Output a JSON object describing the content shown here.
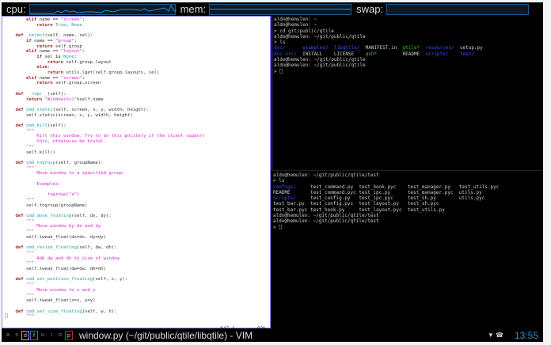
{
  "topbar": {
    "cpu_label": "cpu:",
    "mem_label": "mem:",
    "swap_label": "swap:"
  },
  "vim": {
    "lines": [
      [
        [
          "        ",
          ""
        ],
        [
          "elif",
          "k"
        ],
        [
          " name == ",
          ""
        ],
        [
          "\"screen\"",
          "s"
        ],
        [
          ":",
          ""
        ]
      ],
      [
        [
          "            ",
          ""
        ],
        [
          "return",
          "k"
        ],
        [
          " ",
          ""
        ],
        [
          "True",
          "c"
        ],
        [
          ", ",
          ""
        ],
        [
          "None",
          "c"
        ]
      ],
      [],
      [
        [
          "    ",
          ""
        ],
        [
          "def",
          "k"
        ],
        [
          " ",
          ""
        ],
        [
          "_select",
          "f"
        ],
        [
          "(self, name, sel):",
          ""
        ]
      ],
      [
        [
          "        ",
          ""
        ],
        [
          "if",
          "k"
        ],
        [
          " name == ",
          ""
        ],
        [
          "\"group\"",
          "s"
        ],
        [
          ":",
          ""
        ]
      ],
      [
        [
          "            ",
          ""
        ],
        [
          "return",
          "k"
        ],
        [
          " self.group",
          ""
        ]
      ],
      [
        [
          "        ",
          ""
        ],
        [
          "elif",
          "k"
        ],
        [
          " name == ",
          ""
        ],
        [
          "\"layout\"",
          "s"
        ],
        [
          ":",
          ""
        ]
      ],
      [
        [
          "            ",
          ""
        ],
        [
          "if",
          "k"
        ],
        [
          " sel ",
          ""
        ],
        [
          "is",
          "k"
        ],
        [
          " ",
          ""
        ],
        [
          "None",
          "c"
        ],
        [
          ":",
          ""
        ]
      ],
      [
        [
          "                ",
          ""
        ],
        [
          "return",
          "k"
        ],
        [
          " self.group.layout",
          ""
        ]
      ],
      [
        [
          "            ",
          ""
        ],
        [
          "else",
          "k"
        ],
        [
          ":",
          ""
        ]
      ],
      [
        [
          "                ",
          ""
        ],
        [
          "return",
          "k"
        ],
        [
          " utils.lget(self.group.layouts, sel)",
          ""
        ]
      ],
      [
        [
          "        ",
          ""
        ],
        [
          "elif",
          "k"
        ],
        [
          " name == ",
          ""
        ],
        [
          "\"screen\"",
          "s"
        ],
        [
          ":",
          ""
        ]
      ],
      [
        [
          "            ",
          ""
        ],
        [
          "return",
          "k"
        ],
        [
          " self.group.screen",
          ""
        ]
      ],
      [],
      [
        [
          "    ",
          ""
        ],
        [
          "def",
          "k"
        ],
        [
          " ",
          ""
        ],
        [
          "__repr__",
          "f"
        ],
        [
          "(self):",
          ""
        ]
      ],
      [
        [
          "        ",
          ""
        ],
        [
          "return",
          "k"
        ],
        [
          " ",
          ""
        ],
        [
          "\"Window(%s)\"",
          "s"
        ],
        [
          "%self.name",
          ""
        ]
      ],
      [],
      [
        [
          "    ",
          ""
        ],
        [
          "def",
          "k"
        ],
        [
          " ",
          ""
        ],
        [
          "cmd_static",
          "f"
        ],
        [
          "(self, screen, x, y, width, height):",
          ""
        ]
      ],
      [
        [
          "        self.static(screen, x, y, width, height)",
          ""
        ]
      ],
      [],
      [
        [
          "    ",
          ""
        ],
        [
          "def",
          "k"
        ],
        [
          " ",
          ""
        ],
        [
          "cmd_kill",
          "f"
        ],
        [
          "(self):",
          ""
        ]
      ],
      [
        [
          "        ",
          ""
        ],
        [
          "\"\"\"",
          "d"
        ]
      ],
      [
        [
          "            ",
          ""
        ],
        [
          "Kill this window. Try to do this politely if the client support",
          "d"
        ]
      ],
      [
        [
          "            ",
          ""
        ],
        [
          "this, otherwise be brutal.",
          "d"
        ]
      ],
      [
        [
          "        ",
          ""
        ],
        [
          "\"\"\"",
          "d"
        ]
      ],
      [
        [
          "        self.kill()",
          ""
        ]
      ],
      [],
      [
        [
          "    ",
          ""
        ],
        [
          "def",
          "k"
        ],
        [
          " ",
          ""
        ],
        [
          "cmd_togroup",
          "f"
        ],
        [
          "(self, groupName):",
          ""
        ]
      ],
      [
        [
          "        ",
          ""
        ],
        [
          "\"\"\"",
          "d"
        ]
      ],
      [
        [
          "            ",
          ""
        ],
        [
          "Move window to a specified group.",
          "d"
        ]
      ],
      [],
      [
        [
          "            ",
          ""
        ],
        [
          "Examples:",
          "d"
        ]
      ],
      [],
      [
        [
          "                ",
          ""
        ],
        [
          "togroup(\"a\")",
          "d"
        ]
      ],
      [
        [
          "        ",
          ""
        ],
        [
          "\"\"\"",
          "d"
        ]
      ],
      [
        [
          "        self.togroup(groupName)",
          ""
        ]
      ],
      [],
      [
        [
          "    ",
          ""
        ],
        [
          "def",
          "k"
        ],
        [
          " ",
          ""
        ],
        [
          "cmd_move_floating",
          "f"
        ],
        [
          "(self, dx, dy):",
          ""
        ]
      ],
      [
        [
          "        ",
          ""
        ],
        [
          "\"\"\"",
          "d"
        ]
      ],
      [
        [
          "            ",
          ""
        ],
        [
          "Move window by dx and dy",
          "d"
        ]
      ],
      [
        [
          "        ",
          ""
        ],
        [
          "\"\"\"",
          "d"
        ]
      ],
      [
        [
          "        self.tweak_float(dx=dx, dy=dy)",
          ""
        ]
      ],
      [],
      [
        [
          "    ",
          ""
        ],
        [
          "def",
          "k"
        ],
        [
          " ",
          ""
        ],
        [
          "cmd_resize_floating",
          "f"
        ],
        [
          "(self, dw, dh):",
          ""
        ]
      ],
      [
        [
          "        ",
          ""
        ],
        [
          "\"\"\"",
          "d"
        ]
      ],
      [
        [
          "            ",
          ""
        ],
        [
          "Add dw and dh to size of window",
          "d"
        ]
      ],
      [
        [
          "        ",
          ""
        ],
        [
          "\"\"\"",
          "d"
        ]
      ],
      [
        [
          "        self.tweak_float(dw=dw, dh=dh)",
          ""
        ]
      ],
      [],
      [
        [
          "    ",
          ""
        ],
        [
          "def",
          "k"
        ],
        [
          " ",
          ""
        ],
        [
          "cmd_set_position_floating",
          "f"
        ],
        [
          "(self, x, y):",
          ""
        ]
      ],
      [
        [
          "        ",
          ""
        ],
        [
          "\"\"\"",
          "d"
        ]
      ],
      [
        [
          "            ",
          ""
        ],
        [
          "Move window to x and y",
          "d"
        ]
      ],
      [
        [
          "        ",
          ""
        ],
        [
          "\"\"\"",
          "d"
        ]
      ],
      [
        [
          "        self.tweak_float(x=x, y=y)",
          ""
        ]
      ],
      [],
      [
        [
          "    ",
          ""
        ],
        [
          "def",
          "k"
        ],
        [
          " ",
          ""
        ],
        [
          "cmd_set_size_floating",
          "f"
        ],
        [
          "(self, w, h):",
          ""
        ]
      ],
      [
        [
          "⎕       ",
          ""
        ],
        [
          "\"\"\"",
          "d"
        ]
      ]
    ],
    "position": "847,1",
    "percent": "93%"
  },
  "term_top": [
    [
      [
        "aldo@hemulen: ~",
        ""
      ]
    ],
    [
      [
        "aldo@hemulen: ~",
        ""
      ]
    ],
    [
      [
        "> cd git/public/qtile",
        ""
      ]
    ],
    [
      [
        "aldo@hemulen: ~/git/public/qtile",
        ""
      ]
    ],
    [
      [
        "> ls",
        ""
      ]
    ],
    [
      [
        "doc/",
        "b"
      ],
      [
        "      ",
        ""
      ],
      [
        "examples/",
        "b"
      ],
      [
        "  ",
        ""
      ],
      [
        "libqtile/",
        "b"
      ],
      [
        "  MANIFEST.in  ",
        ""
      ],
      [
        "qtile*",
        "g"
      ],
      [
        "  ",
        ""
      ],
      [
        "resources/",
        "b"
      ],
      [
        "  setup.py",
        ""
      ]
    ],
    [
      [
        "doc-src/",
        "b"
      ],
      [
        "  INSTALL    LICENSE    ",
        ""
      ],
      [
        "qsh*",
        "g"
      ],
      [
        "         README  ",
        ""
      ],
      [
        "scripts/",
        "b"
      ],
      [
        "    ",
        ""
      ],
      [
        "test/",
        "b"
      ]
    ],
    [
      [
        "aldo@hemulen: ~/git/public/qtile",
        ""
      ]
    ],
    [
      [
        "aldo@hemulen: ~/git/public/qtile",
        ""
      ]
    ],
    [
      [
        "> ⎕",
        ""
      ]
    ]
  ],
  "term_bottom": [
    [
      [
        "aldo@hemulen: ~/git/public/qtile/test",
        ""
      ]
    ],
    [
      [
        "> ls",
        ""
      ]
    ],
    [
      [
        "configs/",
        "b"
      ],
      [
        "     test_command.py  test_hook.pyc    test_manager.py   test_utils.pyc",
        ""
      ]
    ],
    [
      [
        "README       test_command.pyc test_ipc.py      test_manager.pyc  utils.py",
        ""
      ]
    ],
    [
      [
        "scripts/",
        "b"
      ],
      [
        "     test_config.py   test_ipc.pyc     test_sh.py        utils.pyc",
        ""
      ]
    ],
    [
      [
        "test_bar.py  test_config.pyc  test_layout.py   test_sh.pyc",
        ""
      ]
    ],
    [
      [
        "test_bar.pyc test_hook.py     test_layout.pyc  test_utils.py",
        ""
      ]
    ],
    [
      [
        "aldo@hemulen: ~/git/public/qtile/test",
        ""
      ]
    ],
    [
      [
        "aldo@hemulen: ~/git/public/qtile/test",
        ""
      ]
    ],
    [
      [
        "> ⎕",
        ""
      ]
    ]
  ],
  "bottombar": {
    "groups": [
      {
        "name": "a",
        "state": ""
      },
      {
        "name": "s",
        "state": ""
      },
      {
        "name": "d",
        "state": "cur"
      },
      {
        "name": "f",
        "state": "act"
      },
      {
        "name": "u",
        "state": ""
      },
      {
        "name": "i",
        "state": ""
      },
      {
        "name": "o",
        "state": ""
      },
      {
        "name": "p",
        "state": "urg"
      }
    ],
    "window_title": "window.py (~/git/public/qtile/libqtile) - VIM",
    "clock": "13:55"
  }
}
